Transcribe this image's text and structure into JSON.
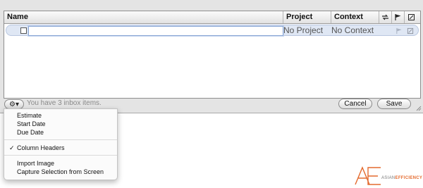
{
  "table": {
    "headers": {
      "name": "Name",
      "project": "Project",
      "context": "Context"
    },
    "header_icons": [
      "repeat-icon",
      "flag-icon",
      "note-icon"
    ],
    "rows": [
      {
        "name": "",
        "project": "No Project",
        "context": "No Context",
        "icons": [
          "flag-icon",
          "note-icon"
        ]
      }
    ]
  },
  "footer": {
    "gear_label": "⚙▾",
    "status": "You have 3 inbox items.",
    "cancel_label": "Cancel",
    "save_label": "Save"
  },
  "menu": {
    "group1": [
      "Estimate",
      "Start Date",
      "Due Date"
    ],
    "column_headers": {
      "label": "Column Headers",
      "checked": true,
      "check_glyph": "✓"
    },
    "group3": [
      "Import Image",
      "Capture Selection from Screen"
    ]
  },
  "logo": {
    "mark": "AE",
    "text_a": "ASIAN",
    "text_b": "EFFICIENCY"
  },
  "colors": {
    "selection": "#dfe7f4",
    "logo_accent": "#e46a2e"
  }
}
